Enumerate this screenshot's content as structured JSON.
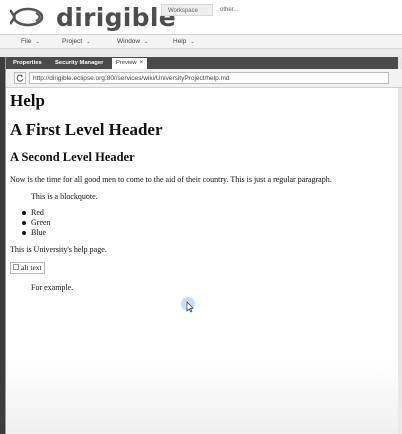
{
  "brand": {
    "name": "dirigible",
    "perspectives": [
      "Workspace",
      "other..."
    ]
  },
  "menu": {
    "items": [
      "File",
      "Project",
      "Window",
      "Help"
    ]
  },
  "tabs": {
    "items": [
      "Properties",
      "Security Manager",
      "Preview"
    ],
    "active": "Preview"
  },
  "address": {
    "url": "http://dirigible.eclipse.org:80//services/wiki/UniversityProject/help.md"
  },
  "document": {
    "title": "Help",
    "h1": "A First Level Header",
    "h2": "A Second Level Header",
    "paragraph": "Now is the time for all good men to come to the aid of their country. This is just a regular paragraph.",
    "blockquote": "This is a blockquote.",
    "list": [
      "Red",
      "Green",
      "Blue"
    ],
    "paragraph2": "This is University's help page.",
    "image_alt": "alt text",
    "example": "For example."
  },
  "colors": {
    "tab_bar": "#4a4a4a",
    "logo_gray": "#4d4d4d",
    "cursor_glow": "#9ec2f2"
  }
}
